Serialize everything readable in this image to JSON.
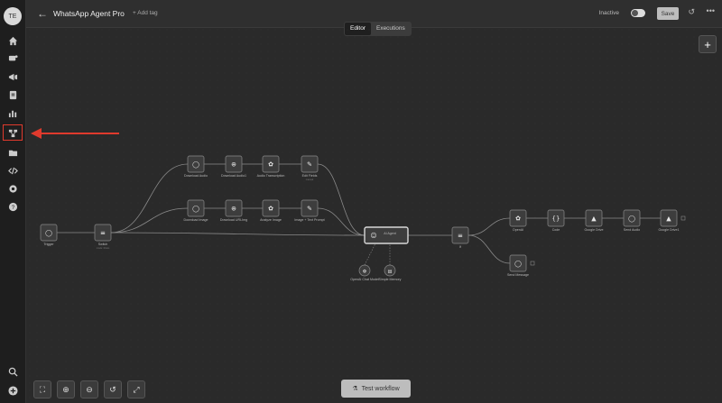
{
  "app": {
    "title": "WhatsApp Agent Pro",
    "add_tag": "+ Add tag",
    "status_label": "Inactive",
    "save_label": "Save"
  },
  "tabs": [
    {
      "label": "Editor"
    },
    {
      "label": "Executions"
    }
  ],
  "sidebar": {
    "avatar_initials": "TE"
  },
  "footer": {
    "test_label": "Test workflow"
  },
  "nodes": [
    {
      "label": "Trigger",
      "sub": "",
      "icon": "whatsapp-icon"
    },
    {
      "label": "Switch",
      "sub": "mode: Rules",
      "icon": "switch-icon"
    },
    {
      "label": "Download Audio",
      "sub": "",
      "icon": "whatsapp-icon"
    },
    {
      "label": "Download Audio1",
      "sub": "",
      "icon": "globe-icon"
    },
    {
      "label": "Audio Transcription",
      "sub": "",
      "icon": "openai-icon"
    },
    {
      "label": "Edit Fields",
      "sub": "manual",
      "icon": "pencil-icon"
    },
    {
      "label": "Download Image",
      "sub": "",
      "icon": "whatsapp-icon"
    },
    {
      "label": "Download URLImg",
      "sub": "",
      "icon": "globe-icon"
    },
    {
      "label": "Analyze Image",
      "sub": "",
      "icon": "openai-icon"
    },
    {
      "label": "Image + Text Prompt",
      "sub": "",
      "icon": "pencil-icon"
    },
    {
      "label": "AI Agent",
      "sub": "",
      "icon": "robot-icon"
    },
    {
      "label": "OpenAI Chat Model",
      "sub": "",
      "icon": "openai-icon"
    },
    {
      "label": "Simple Memory",
      "sub": "",
      "icon": "memory-icon"
    },
    {
      "label": "If",
      "sub": "",
      "icon": "switch-icon"
    },
    {
      "label": "OpenAI",
      "sub": "",
      "icon": "openai-icon"
    },
    {
      "label": "Code",
      "sub": "",
      "icon": "code-icon"
    },
    {
      "label": "Google Drive",
      "sub": "",
      "icon": "drive-icon"
    },
    {
      "label": "Send Audio",
      "sub": "",
      "icon": "whatsapp-icon"
    },
    {
      "label": "Google Drive1",
      "sub": "",
      "icon": "drive-icon"
    },
    {
      "label": "Send Message",
      "sub": "",
      "icon": "whatsapp-icon"
    }
  ]
}
